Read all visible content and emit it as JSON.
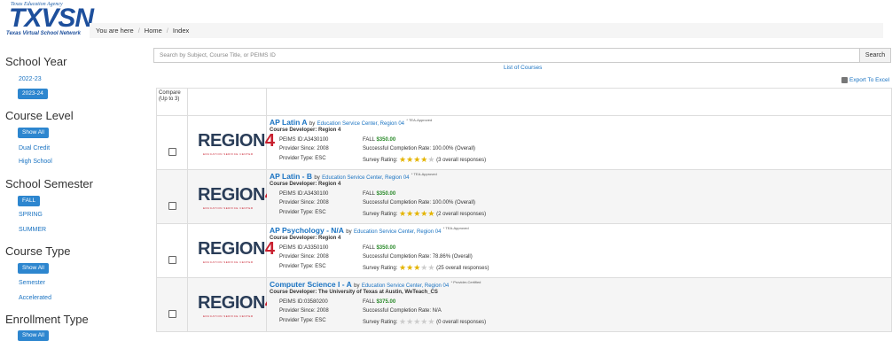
{
  "logo": {
    "agency": "Texas Education Agency",
    "main": "TXVSN",
    "sub": "Texas Virtual School Network"
  },
  "breadcrumb": {
    "you_are_here": "You are here",
    "home": "Home",
    "current": "Index"
  },
  "sidebar": {
    "school_year": {
      "title": "School Year",
      "items": [
        "2022-23",
        "2023-24"
      ],
      "selected": "2023-24"
    },
    "course_level": {
      "title": "Course Level",
      "show_all": "Show All",
      "items": [
        "Dual Credit",
        "High School"
      ]
    },
    "school_semester": {
      "title": "School Semester",
      "selected": "FALL",
      "items": [
        "SPRING",
        "SUMMER"
      ]
    },
    "course_type": {
      "title": "Course Type",
      "show_all": "Show All",
      "items": [
        "Semester",
        "Accelerated"
      ]
    },
    "enrollment_type": {
      "title": "Enrollment Type",
      "show_all": "Show All"
    }
  },
  "search": {
    "placeholder": "Search by Subject, Course Title, or PEIMS ID",
    "button": "Search"
  },
  "list_of_courses": "List of Courses",
  "export": "Export To Excel",
  "table": {
    "compare_header": "Compare (Up to 3)"
  },
  "courses": [
    {
      "title": "AP Latin  A",
      "by": "by",
      "provider": "Education Service Center, Region 04",
      "badge": "* TEA-Approved",
      "developer": "Course Developer: Region 4",
      "peims": "PEIMS ID:A3430100",
      "since": "Provider Since: 2008",
      "type": "Provider Type: ESC",
      "price_label": "FALL",
      "price": "$350.00",
      "completion": "Successful Completion Rate: 100.00% (Overall)",
      "survey_label": "Survey Rating:",
      "rating": 4,
      "responses": "(3 overall responses)"
    },
    {
      "title": "AP Latin - B",
      "by": "by",
      "provider": "Education Service Center, Region 04",
      "badge": "* TEA-Approved",
      "developer": "Course Developer: Region 4",
      "peims": "PEIMS ID:A3430100",
      "since": "Provider Since: 2008",
      "type": "Provider Type: ESC",
      "price_label": "FALL",
      "price": "$350.00",
      "completion": "Successful Completion Rate: 100.00% (Overall)",
      "survey_label": "Survey Rating:",
      "rating": 5,
      "responses": "(2 overall responses)"
    },
    {
      "title": "AP Psychology - N/A",
      "by": "by",
      "provider": "Education Service Center, Region 04",
      "badge": "* TEA-Approved",
      "developer": "Course Developer: Region 4",
      "peims": "PEIMS ID:A3350100",
      "since": "Provider Since: 2008",
      "type": "Provider Type: ESC",
      "price_label": "FALL",
      "price": "$350.00",
      "completion": "Successful Completion Rate: 78.86% (Overall)",
      "survey_label": "Survey Rating:",
      "rating": 3,
      "responses": "(25 overall responses)"
    },
    {
      "title": "Computer Science I - A",
      "by": "by",
      "provider": "Education Service Center, Region 04",
      "badge": "* Provider-Certified",
      "developer": "Course Developer: The University of Texas at Austin, WeTeach_CS",
      "peims": "PEIMS ID:03580200",
      "since": "Provider Since: 2008",
      "type": "Provider Type: ESC",
      "price_label": "FALL",
      "price": "$375.00",
      "completion": "Successful Completion Rate: N/A",
      "survey_label": "Survey Rating:",
      "rating": 0,
      "responses": "(0 overall responses)"
    }
  ],
  "region_logo": {
    "text": "REGION",
    "x": "4",
    "tagline": "EDUCATION SERVICE CENTER"
  },
  "colors": {
    "link": "#1a73c2",
    "button": "#2d86cf",
    "price": "#2a8a2a",
    "star": "#e4b400"
  }
}
